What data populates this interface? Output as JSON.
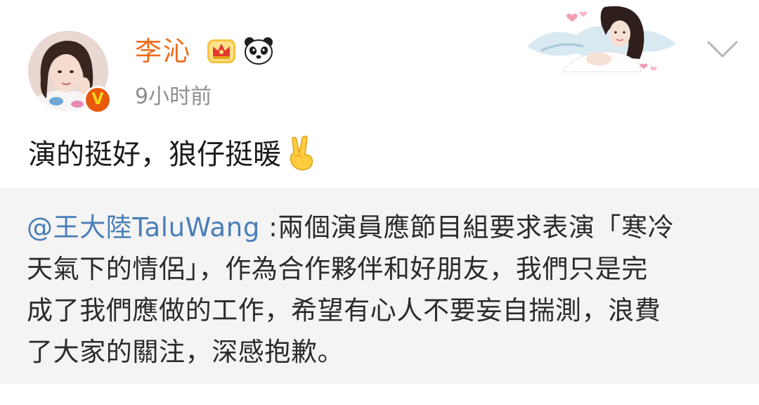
{
  "post": {
    "author": {
      "name": "李沁",
      "verified_badge": "V",
      "avatar_icon": "user-avatar",
      "badges": [
        "crown-icon",
        "panda-icon"
      ]
    },
    "timestamp": "9小时前",
    "text": "演的挺好，狼仔挺暖",
    "text_emoji": "victory-hand-icon",
    "menu_icon": "chevron-down-icon"
  },
  "quote": {
    "mention": "@王大陸TaluWang",
    "lines": [
      " :兩個演員應節目組要求表演「寒冷",
      "天氣下的情侶」，作為合作夥伴和好朋友，我們只是完",
      "成了我們應做的工作，希望有心人不要妄自揣測，浪費",
      "了大家的關注，深感抱歉。"
    ]
  },
  "colors": {
    "username": "#f06c1b",
    "mention": "#4a7eb8",
    "timestamp": "#8e8e8e",
    "quote_background": "#f4f4f4",
    "verified_badge": "#e8590c"
  }
}
